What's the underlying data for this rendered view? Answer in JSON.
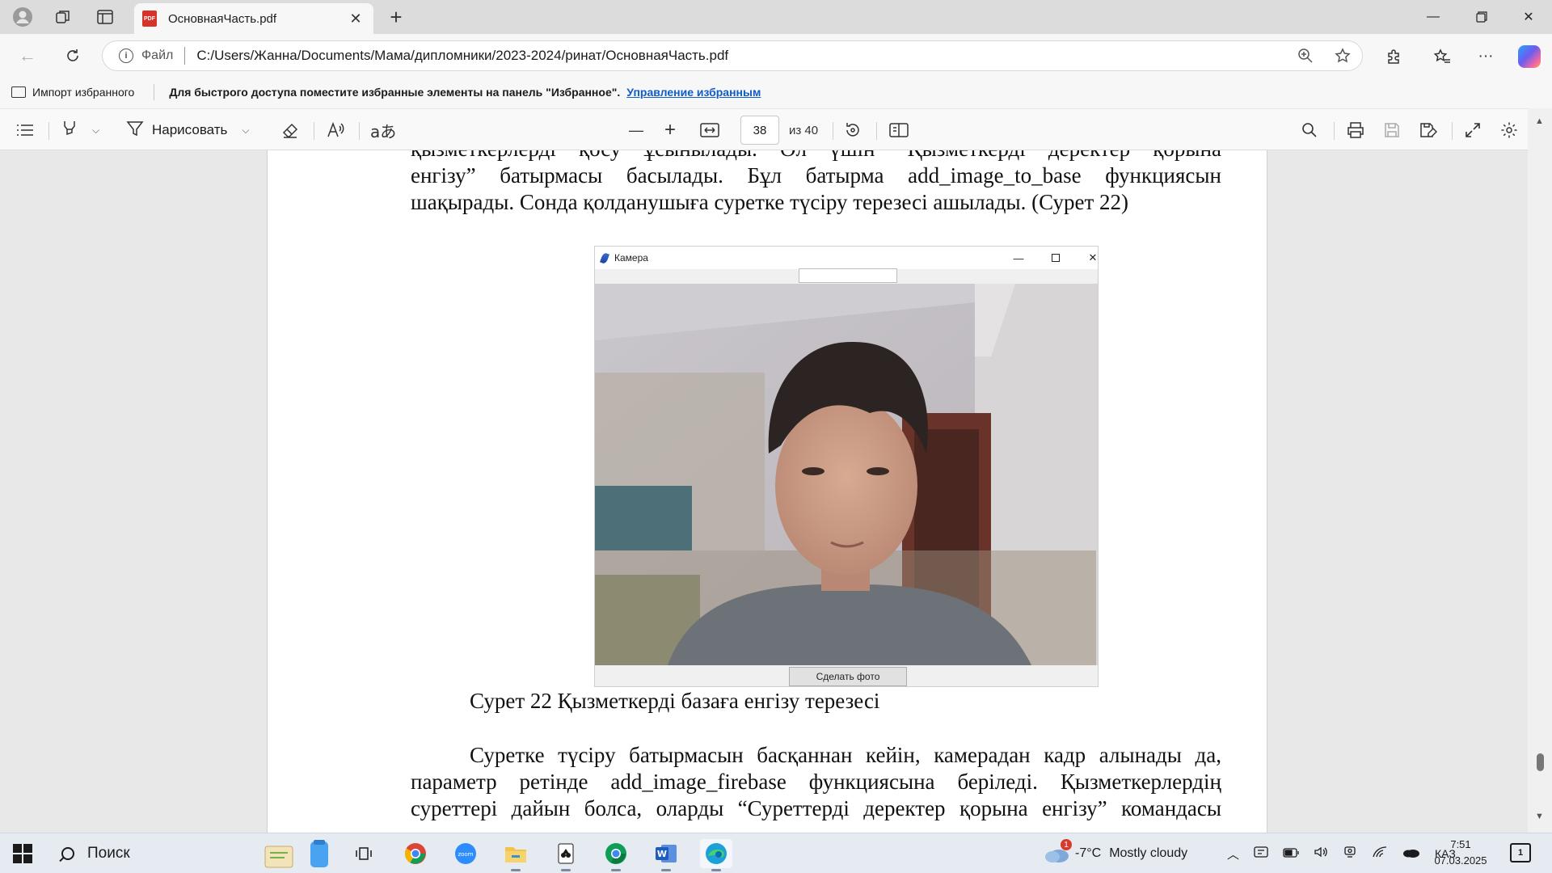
{
  "browser": {
    "tab_title": "ОсновнаяЧасть.pdf",
    "address": {
      "file_label": "Файл",
      "url": "C:/Users/Жанна/Documents/Мама/дипломники/2023-2024/ринат/ОсновнаяЧасть.pdf"
    },
    "favorites_bar": {
      "import_label": "Импорт избранного",
      "hint": "Для быстрого доступа поместите избранные элементы на панель \"Избранное\".",
      "manage_link": "Управление избранным"
    }
  },
  "pdf_toolbar": {
    "draw_label": "Нарисовать",
    "current_page": "38",
    "page_of": "из 40"
  },
  "document": {
    "lines_top": [
      "қызметкерлерді қосу ұсынылады. Ол үшін “Қызметкерді деректер қорына",
      "енгізу” батырмасы басылады. Бұл батырма add_image_to_base функциясын",
      "шақырады. Сонда қолданушыға суретке түсіру терезесі ашылады. (Сурет 22)"
    ],
    "camera_window": {
      "title": "Камера",
      "button_label": "Сделать фото"
    },
    "caption": "Сурет 22 Қызметкерді базаға енгізу терезесі",
    "lines_bottom": [
      "Суретке түсіру батырмасын басқаннан кейін, камерадан кадр алынады да,",
      "параметр ретінде add_image_firebase функциясына беріледі. Қызметкерлердің",
      "суреттері дайын болса, оларды “Суреттерді деректер қорына енгізу” командасы"
    ]
  },
  "taskbar": {
    "search_placeholder": "Поиск",
    "weather": {
      "temp": "-7°C",
      "condition": "Mostly cloudy",
      "badge": "1"
    },
    "language": "КАЗ",
    "time": "7:51",
    "date": "07.03.2025",
    "notification_count": "1"
  },
  "colors": {
    "link": "#0f5cc9",
    "pdf_badge": "#d6332a",
    "copilot_gradient": [
      "#2fa3f7",
      "#6b5cf0",
      "#f56aa0",
      "#f5b23b"
    ]
  },
  "icons": {
    "toolbar": [
      "profile-icon",
      "workspaces-icon",
      "tab-actions-icon",
      "extensions-icon",
      "favorites-icon",
      "more-icon",
      "copilot-icon"
    ],
    "pdf": [
      "contents-icon",
      "highlight-icon",
      "draw-icon",
      "eraser-icon",
      "read-aloud-icon",
      "translate-icon",
      "zoom-out-icon",
      "zoom-in-icon",
      "fit-width-icon",
      "rotate-icon",
      "page-view-icon",
      "search-icon",
      "print-icon",
      "save-icon",
      "save-as-icon",
      "fullscreen-icon",
      "settings-icon"
    ]
  }
}
